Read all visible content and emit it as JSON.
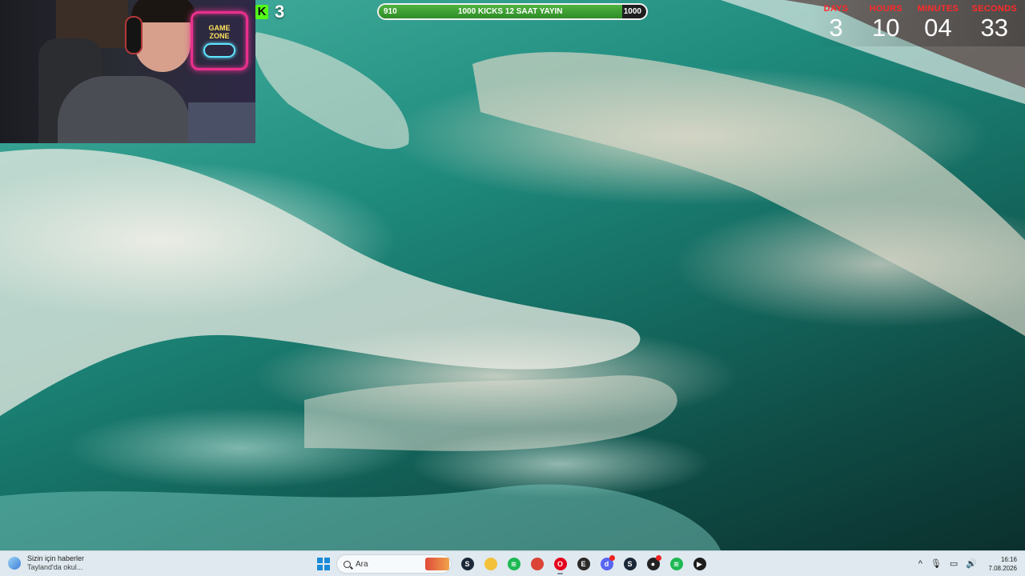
{
  "overlay": {
    "kick_count": "3",
    "goal": {
      "start": "910",
      "title": "1000 KICKS 12 SAAT YAYIN",
      "end": "1000",
      "progress_fraction": 0.91
    },
    "countdown": {
      "days_label": "DAYS",
      "days": "3",
      "hours_label": "HOURS",
      "hours": "10",
      "minutes_label": "MINUTES",
      "minutes": "04",
      "seconds_label": "SECONDS",
      "seconds": "33"
    },
    "webcam": {
      "sign_line1": "GAME",
      "sign_line2": "ZONE"
    }
  },
  "taskbar": {
    "news": {
      "title": "Sizin için haberler",
      "subtitle": "Tayland'da okul..."
    },
    "search_placeholder": "Ara",
    "apps": [
      {
        "name": "steam-icon",
        "glyph": "S",
        "color": "#1b2838"
      },
      {
        "name": "file-explorer-icon",
        "glyph": "",
        "color": "#f3c13a"
      },
      {
        "name": "spotify-icon",
        "glyph": "≋",
        "color": "#1db954"
      },
      {
        "name": "chrome-icon",
        "glyph": "",
        "color": "#db4437"
      },
      {
        "name": "opera-icon",
        "glyph": "O",
        "color": "#e5001d"
      },
      {
        "name": "epic-games-icon",
        "glyph": "E",
        "color": "#2a2a2a"
      },
      {
        "name": "discord-icon",
        "glyph": "d",
        "color": "#5865f2"
      },
      {
        "name": "steam-icon-2",
        "glyph": "S",
        "color": "#1b2838"
      },
      {
        "name": "obs-icon",
        "glyph": "●",
        "color": "#222222"
      },
      {
        "name": "spotify-icon-2",
        "glyph": "≋",
        "color": "#1db954"
      },
      {
        "name": "streamer-app-icon",
        "glyph": "▶",
        "color": "#1d1d1d"
      }
    ],
    "tray": {
      "chevron": "^",
      "mic": "🎙",
      "display": "▭",
      "volume": "🔊"
    },
    "clock": {
      "time": "16:16",
      "date": "7.08.2026"
    }
  }
}
